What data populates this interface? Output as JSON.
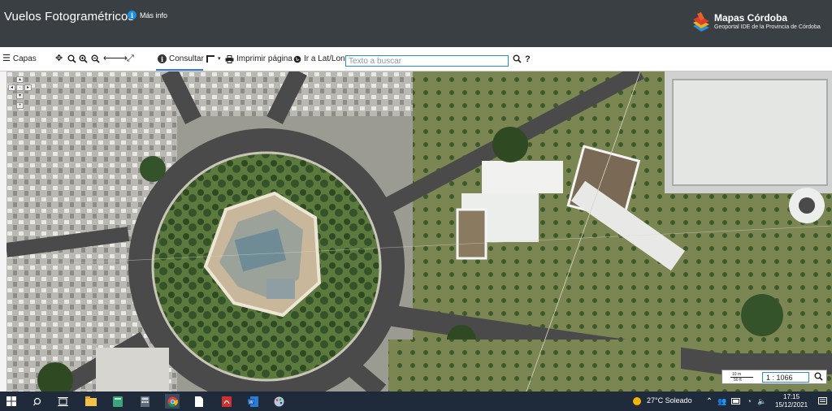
{
  "header": {
    "title": "Vuelos Fotogramétricos",
    "info_label": "Más info",
    "brand_name": "Mapas Córdoba",
    "brand_subtitle": "Geoportal IDE de la Provincia de Córdoba"
  },
  "toolbar": {
    "layers_label": "Capas",
    "consultar_label": "Consultar",
    "print_label": "Imprimir página",
    "goto_label": "Ir a Lat/Lon",
    "search_placeholder": "Texto a buscar",
    "help_label": "?"
  },
  "map": {
    "scale_top": "10 m",
    "scale_bottom": "50 ft",
    "scale_value": "1 : 1066"
  },
  "taskbar": {
    "weather": "27°C  Soleado",
    "time": "17:15",
    "date": "15/12/2021"
  },
  "colors": {
    "header_bg": "#3a3f44",
    "accent": "#2b8ecf",
    "taskbar_bg": "#1f2a3a"
  }
}
